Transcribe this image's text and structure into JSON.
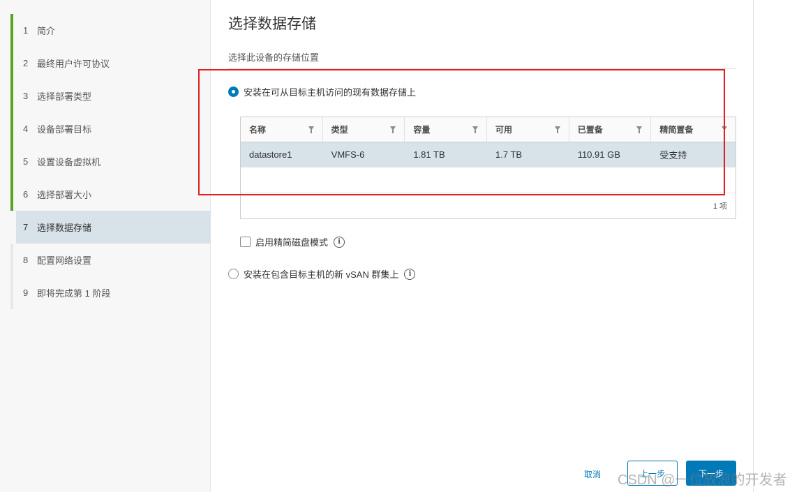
{
  "sidebar": {
    "steps": [
      {
        "num": "1",
        "label": "简介",
        "state": "done"
      },
      {
        "num": "2",
        "label": "最终用户许可协议",
        "state": "done"
      },
      {
        "num": "3",
        "label": "选择部署类型",
        "state": "done"
      },
      {
        "num": "4",
        "label": "设备部署目标",
        "state": "done"
      },
      {
        "num": "5",
        "label": "设置设备虚拟机",
        "state": "done"
      },
      {
        "num": "6",
        "label": "选择部署大小",
        "state": "done"
      },
      {
        "num": "7",
        "label": "选择数据存储",
        "state": "active"
      },
      {
        "num": "8",
        "label": "配置网络设置",
        "state": "pending"
      },
      {
        "num": "9",
        "label": "即将完成第 1 阶段",
        "state": "pending"
      }
    ]
  },
  "main": {
    "title": "选择数据存储",
    "subtitle": "选择此设备的存储位置",
    "option_existing": "安装在可从目标主机访问的现有数据存储上",
    "option_vsan": "安装在包含目标主机的新 vSAN 群集上",
    "thin_disk_label": "启用精简磁盘模式",
    "grid": {
      "columns": [
        "名称",
        "类型",
        "容量",
        "可用",
        "已置备",
        "精简置备"
      ],
      "rows": [
        [
          "datastore1",
          "VMFS-6",
          "1.81 TB",
          "1.7 TB",
          "110.91 GB",
          "受支持"
        ]
      ],
      "footer": "1 项"
    }
  },
  "footer": {
    "cancel": "取消",
    "prev": "上一步",
    "next": "下一步"
  },
  "watermark": "CSDN @一位放浪的开发者",
  "colors": {
    "accent": "#0079b8",
    "done_bar": "#5aa220",
    "selected_row": "#d8e3e9",
    "highlight_box": "#e02020"
  }
}
